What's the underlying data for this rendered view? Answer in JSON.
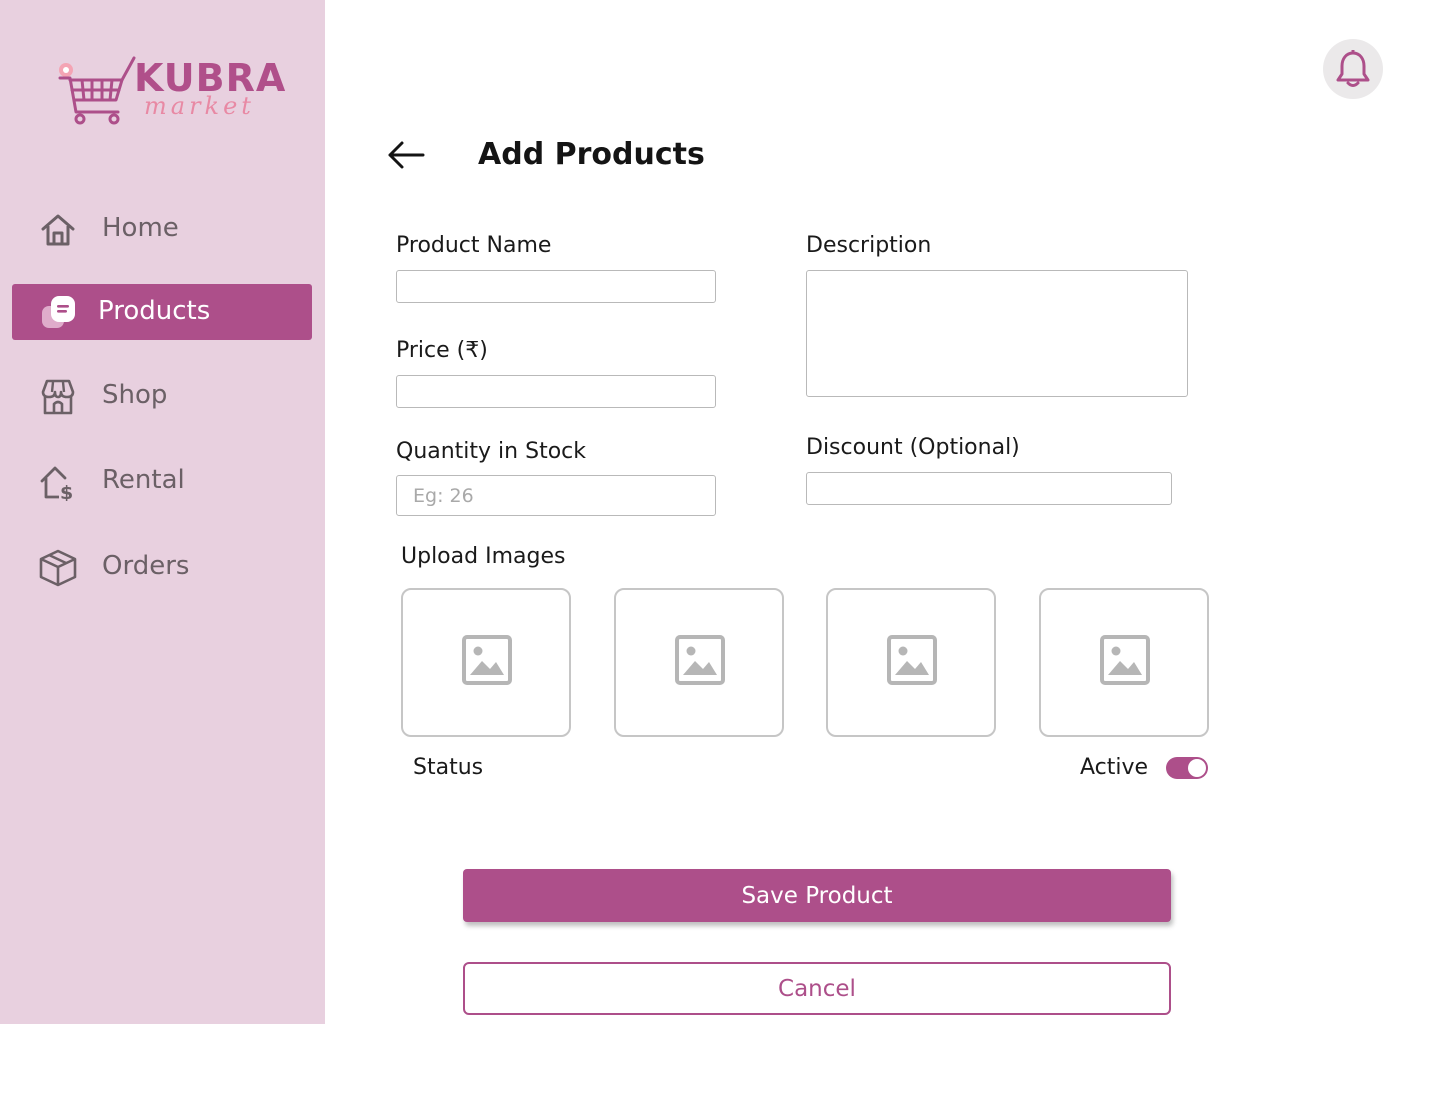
{
  "brand": {
    "name": "KUBRA",
    "tagline": "market",
    "logo_icon": "shopping-cart-logo"
  },
  "sidebar": {
    "items": [
      {
        "label": "Home",
        "icon": "home-icon",
        "active": false
      },
      {
        "label": "Products",
        "icon": "products-icon",
        "active": true
      },
      {
        "label": "Shop",
        "icon": "shop-icon",
        "active": false
      },
      {
        "label": "Rental",
        "icon": "rental-icon",
        "active": false
      },
      {
        "label": "Orders",
        "icon": "orders-icon",
        "active": false
      }
    ]
  },
  "header": {
    "title": "Add Products",
    "back_icon": "arrow-left-icon",
    "notifications_icon": "bell-icon"
  },
  "form": {
    "product_name": {
      "label": "Product Name",
      "value": "",
      "placeholder": ""
    },
    "price": {
      "label": "Price (₹)",
      "value": "",
      "placeholder": ""
    },
    "quantity": {
      "label": "Quantity in Stock",
      "value": "",
      "placeholder": "Eg: 26"
    },
    "description": {
      "label": "Description",
      "value": "",
      "placeholder": ""
    },
    "discount": {
      "label": "Discount (Optional)",
      "value": "",
      "placeholder": ""
    },
    "upload": {
      "label": "Upload Images",
      "slots": 4,
      "slot_icon": "image-placeholder-icon"
    },
    "status": {
      "label": "Status",
      "value_label": "Active",
      "active": true
    }
  },
  "actions": {
    "save_label": "Save Product",
    "cancel_label": "Cancel"
  },
  "colors": {
    "accent": "#ad4f8a",
    "sidebar_bg": "#e8d0df",
    "logo_pink": "#e889a4",
    "icon_grey": "#6b6066"
  }
}
